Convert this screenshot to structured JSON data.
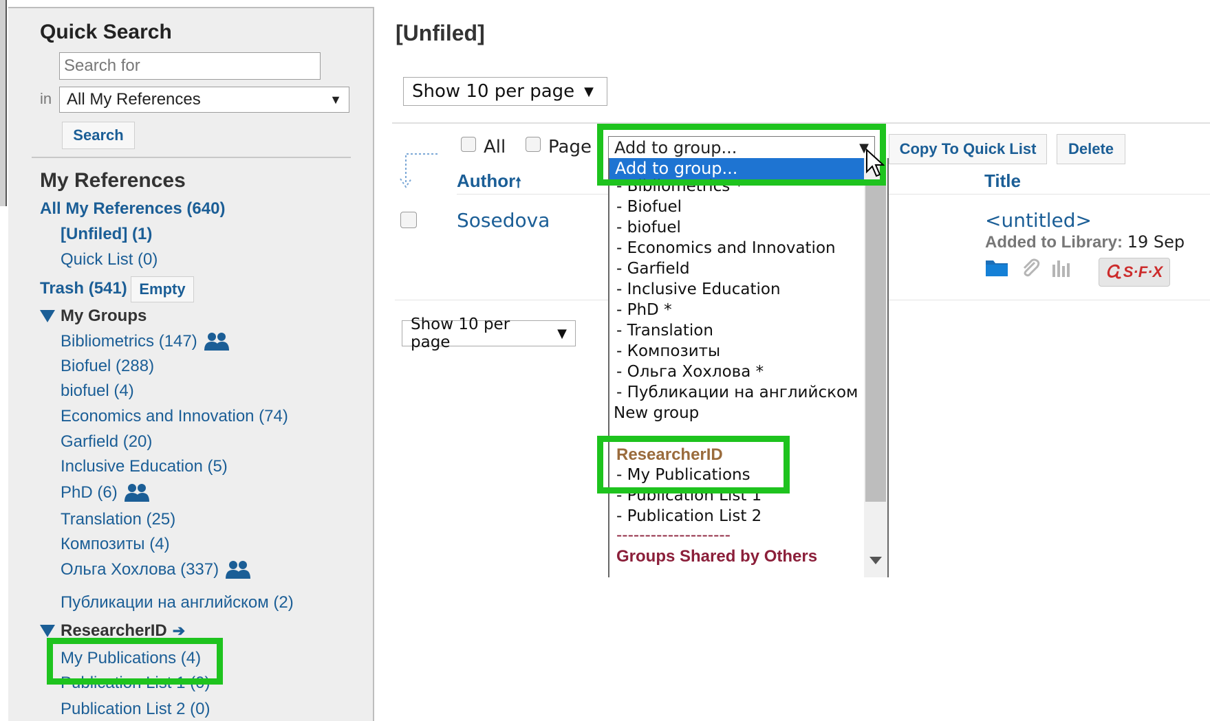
{
  "sidebar": {
    "quick_search_title": "Quick Search",
    "search_placeholder": "Search for",
    "in_label": "in",
    "scope_value": "All My References",
    "search_button": "Search",
    "my_references_title": "My References",
    "all_refs": "All My References (640)",
    "unfiled": "[Unfiled] (1)",
    "quick_list": "Quick List (0)",
    "trash": "Trash (541)",
    "empty_button": "Empty",
    "groups_title": "My Groups",
    "groups": [
      {
        "label": "Bibliometrics  (147)",
        "shared": true
      },
      {
        "label": "Biofuel  (288)",
        "shared": false
      },
      {
        "label": "biofuel  (4)",
        "shared": false
      },
      {
        "label": "Economics and Innovation  (74)",
        "shared": false
      },
      {
        "label": "Garfield  (20)",
        "shared": false
      },
      {
        "label": "Inclusive Education  (5)",
        "shared": false
      },
      {
        "label": "PhD  (6)",
        "shared": true
      },
      {
        "label": "Translation  (25)",
        "shared": false
      },
      {
        "label": "Композиты  (4)",
        "shared": false
      },
      {
        "label": "Ольга Хохлова  (337)",
        "shared": true
      },
      {
        "label": "Публикации на английском  (2)",
        "shared": false
      }
    ],
    "researcherid_title": "ResearcherID",
    "researcherid_items": [
      "My Publications  (4)",
      "Publication List 1  (0)",
      "Publication List 2  (0)"
    ]
  },
  "main": {
    "page_title": "[Unfiled]",
    "per_page": "Show 10 per page",
    "select_all": "All",
    "select_page": "Page",
    "group_select_value": "Add to group...",
    "copy_button": "Copy To Quick List",
    "delete_button": "Delete",
    "col_author": "Author",
    "col_title": "Title",
    "row": {
      "author": "Sosedova",
      "title": "<untitled>",
      "added_label": "Added to Library:",
      "added_value": "19 Sep"
    },
    "sfx_label": "S·F·X"
  },
  "dropdown": {
    "selected": "Add to group...",
    "items": [
      "- Bibliometrics *",
      "- Biofuel",
      "- biofuel",
      "- Economics and Innovation",
      "- Garfield",
      "- Inclusive Education",
      "- PhD *",
      "- Translation",
      "- Композиты",
      "- Ольга Хохлова *",
      "- Публикации на английском",
      "New group"
    ],
    "rid_heading": "ResearcherID",
    "rid_items": [
      "- My Publications",
      "- Publication List 1",
      "- Publication List 2"
    ],
    "separator": "--------------------",
    "shared_heading": "Groups Shared by Others"
  },
  "colors": {
    "link": "#1b5e96",
    "highlight": "#1ec31e",
    "selected_option": "#1e74d2",
    "rid_heading": "#9a6b3c",
    "shared_heading": "#8b1f3a"
  }
}
